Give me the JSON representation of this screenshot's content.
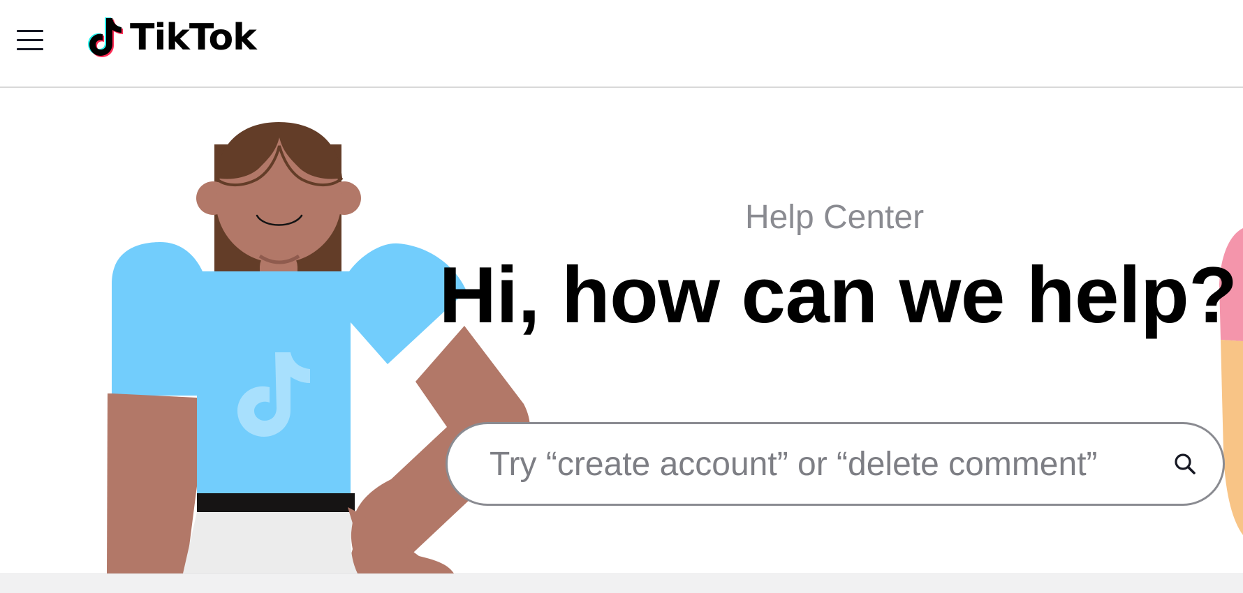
{
  "header": {
    "menu_icon": "hamburger-menu-icon",
    "logo_text": "TikTok",
    "logo_icon": "tiktok-note-icon"
  },
  "hero": {
    "subtitle": "Help Center",
    "title": "Hi, how can we help?",
    "illustration": "person-illustration"
  },
  "search": {
    "placeholder": "Try “create account” or “delete comment”",
    "value": "",
    "icon": "search-icon"
  },
  "colors": {
    "shirt": "#72cdfc",
    "skin": "#b27868",
    "hair": "#633d28",
    "text_primary": "#000000",
    "text_secondary": "#8a8b91",
    "border": "#8a8b91",
    "tiktok_cyan": "#25f4ee",
    "tiktok_red": "#fe2c55"
  }
}
